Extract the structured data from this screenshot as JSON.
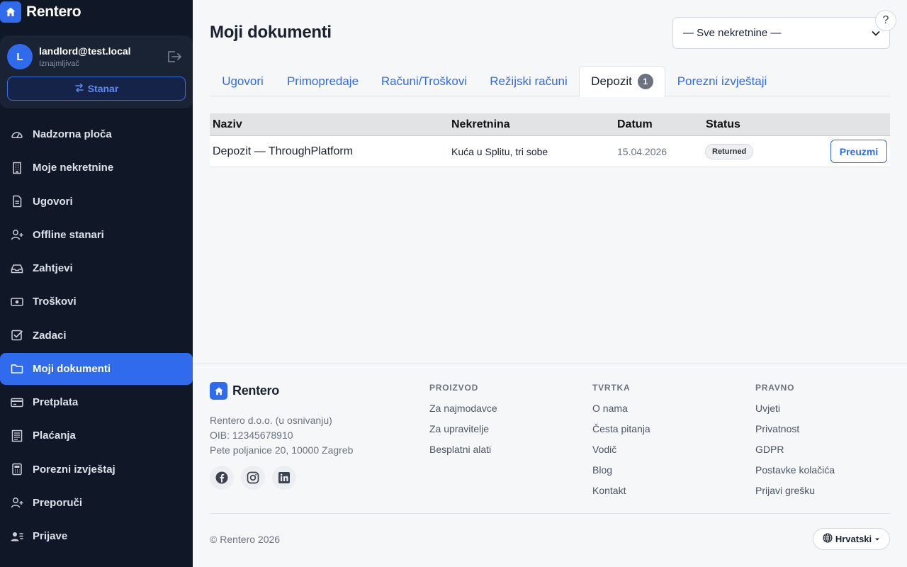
{
  "brand": {
    "name": "Rentero"
  },
  "user": {
    "initial": "L",
    "email": "landlord@test.local",
    "role": "Iznajmljivač",
    "switch_label": "Stanar"
  },
  "nav": {
    "items": [
      {
        "label": "Nadzorna ploča",
        "icon": "dashboard-icon"
      },
      {
        "label": "Moje nekretnine",
        "icon": "building-icon"
      },
      {
        "label": "Ugovori",
        "icon": "document-icon"
      },
      {
        "label": "Offline stanari",
        "icon": "user-plus-icon"
      },
      {
        "label": "Zahtjevi",
        "icon": "inbox-icon"
      },
      {
        "label": "Troškovi",
        "icon": "cash-icon"
      },
      {
        "label": "Zadaci",
        "icon": "checkbox-icon"
      },
      {
        "label": "Moji dokumenti",
        "icon": "folder-icon",
        "active": true
      },
      {
        "label": "Pretplata",
        "icon": "credit-card-icon"
      },
      {
        "label": "Plaćanja",
        "icon": "receipt-icon"
      },
      {
        "label": "Porezni izvještaj",
        "icon": "calculator-icon"
      },
      {
        "label": "Preporuči",
        "icon": "user-plus-icon"
      },
      {
        "label": "Prijave",
        "icon": "user-list-icon"
      }
    ]
  },
  "header": {
    "title": "Moji dokumenti",
    "property_filter": "— Sve nekretnine —",
    "help_label": "?"
  },
  "tabs": [
    {
      "label": "Ugovori"
    },
    {
      "label": "Primopredaje"
    },
    {
      "label": "Računi/Troškovi"
    },
    {
      "label": "Režijski računi"
    },
    {
      "label": "Depozit",
      "badge": "1",
      "active": true
    },
    {
      "label": "Porezni izvještaji"
    }
  ],
  "table": {
    "headers": [
      "Naziv",
      "Nekretnina",
      "Datum",
      "Status"
    ],
    "rows": [
      {
        "name": "Depozit — ThroughPlatform",
        "property": "Kuća u Splitu, tri sobe",
        "date": "15.04.2026",
        "status": "Returned",
        "action": "Preuzmi"
      }
    ]
  },
  "footer": {
    "brand": "Rentero",
    "company": [
      "Rentero d.o.o. (u osnivanju)",
      "OIB: 12345678910",
      "Pete poljanice 20, 10000 Zagreb"
    ],
    "socials": [
      "facebook-icon",
      "instagram-icon",
      "linkedin-icon"
    ],
    "columns": [
      {
        "title": "PROIZVOD",
        "links": [
          "Za najmodavce",
          "Za upravitelje",
          "Besplatni alati"
        ]
      },
      {
        "title": "TVRTKA",
        "links": [
          "O nama",
          "Česta pitanja",
          "Vodič",
          "Blog",
          "Kontakt"
        ]
      },
      {
        "title": "PRAVNO",
        "links": [
          "Uvjeti",
          "Privatnost",
          "GDPR",
          "Postavke kolačića",
          "Prijavi grešku"
        ]
      }
    ],
    "copyright": "© Rentero 2026",
    "language": "Hrvatski"
  },
  "colors": {
    "accent": "#2f6bec",
    "sidebar_bg": "#101828",
    "page_bg": "#f6f7f9"
  }
}
